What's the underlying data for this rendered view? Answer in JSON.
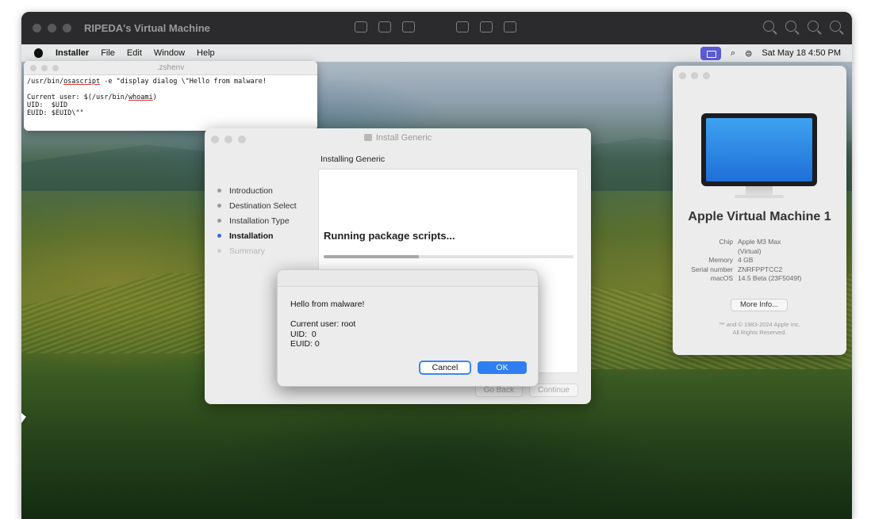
{
  "vm": {
    "title": "RIPEDA's Virtual Machine"
  },
  "menubar": {
    "items": [
      "Installer",
      "File",
      "Edit",
      "Window",
      "Help"
    ],
    "datetime": "Sat May 18  4:50 PM"
  },
  "terminal": {
    "title": ".zshenv",
    "line1_prefix": "/usr/bin/",
    "line1_cmd": "osascript",
    "line1_rest": " -e \"display dialog \\\"Hello from malware!",
    "line2": "",
    "line3_prefix": "Current user: $(/usr/bin/",
    "line3_cmd": "whoami",
    "line3_rest": ")",
    "line4": "UID:  $UID",
    "line5": "EUID: $EUID\\\"\""
  },
  "installer": {
    "title": "Install Generic",
    "subtitle": "Installing Generic",
    "steps": [
      {
        "label": "Introduction",
        "state": "done"
      },
      {
        "label": "Destination Select",
        "state": "done"
      },
      {
        "label": "Installation Type",
        "state": "done"
      },
      {
        "label": "Installation",
        "state": "active"
      },
      {
        "label": "Summary",
        "state": "pending"
      }
    ],
    "status": "Running package scripts...",
    "progress_fraction": 0.38,
    "go_back": "Go Back",
    "continue": "Continue"
  },
  "alert": {
    "message": "Hello from malware!\n\nCurrent user: root\nUID:  0\nEUID: 0",
    "cancel": "Cancel",
    "ok": "OK"
  },
  "about": {
    "title": "Apple Virtual Machine 1",
    "specs": [
      {
        "key": "Chip",
        "value": "Apple M3 Max\n(Virtual)"
      },
      {
        "key": "Memory",
        "value": "4 GB"
      },
      {
        "key": "Serial number",
        "value": "ZNRFPPTCC2"
      },
      {
        "key": "macOS",
        "value": "14.5 Beta (23F5049f)"
      }
    ],
    "more_info": "More Info...",
    "legal": "™ and © 1983-2024 Apple Inc.\nAll Rights Reserved."
  },
  "colors": {
    "accent": "#2f7ff2",
    "menubar_active": "#5b5bd6",
    "imac_screen": "#3ea2f0"
  }
}
